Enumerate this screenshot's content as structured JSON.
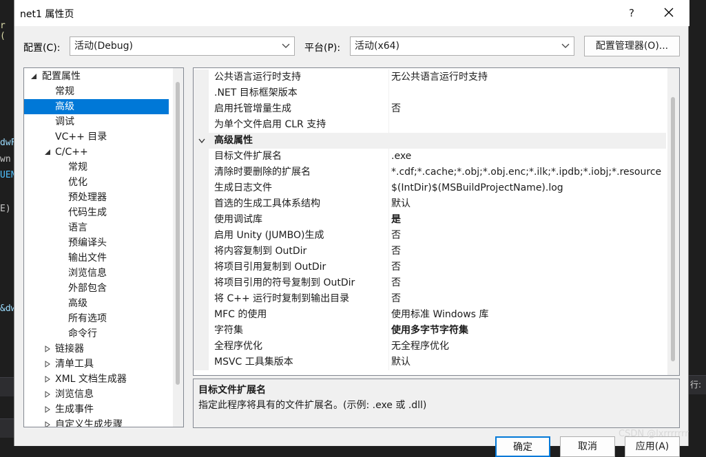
{
  "background": {
    "left_fragments": [
      "r (",
      "dwF",
      "wn",
      "UEN",
      "E)",
      "&dw"
    ],
    "right_fragment": "行:"
  },
  "watermark": "CSDN @lxrrrrrrr",
  "dialog": {
    "title": "net1 属性页",
    "help_label": "?",
    "config": {
      "label": "配置(C):",
      "value": "活动(Debug)"
    },
    "platform": {
      "label": "平台(P):",
      "value": "活动(x64)"
    },
    "manager_button": "配置管理器(O)..."
  },
  "tree": [
    {
      "label": "配置属性",
      "level": 0,
      "state": "expanded"
    },
    {
      "label": "常规",
      "level": 1
    },
    {
      "label": "高级",
      "level": 1,
      "selected": true
    },
    {
      "label": "调试",
      "level": 1
    },
    {
      "label": "VC++ 目录",
      "level": 1
    },
    {
      "label": "C/C++",
      "level": 1,
      "state": "expanded"
    },
    {
      "label": "常规",
      "level": 2
    },
    {
      "label": "优化",
      "level": 2
    },
    {
      "label": "预处理器",
      "level": 2
    },
    {
      "label": "代码生成",
      "level": 2
    },
    {
      "label": "语言",
      "level": 2
    },
    {
      "label": "预编译头",
      "level": 2
    },
    {
      "label": "输出文件",
      "level": 2
    },
    {
      "label": "浏览信息",
      "level": 2
    },
    {
      "label": "外部包含",
      "level": 2
    },
    {
      "label": "高级",
      "level": 2
    },
    {
      "label": "所有选项",
      "level": 2
    },
    {
      "label": "命令行",
      "level": 2
    },
    {
      "label": "链接器",
      "level": 1,
      "state": "collapsed"
    },
    {
      "label": "清单工具",
      "level": 1,
      "state": "collapsed"
    },
    {
      "label": "XML 文档生成器",
      "level": 1,
      "state": "collapsed"
    },
    {
      "label": "浏览信息",
      "level": 1,
      "state": "collapsed"
    },
    {
      "label": "生成事件",
      "level": 1,
      "state": "collapsed"
    },
    {
      "label": "自定义生成步骤",
      "level": 1,
      "state": "collapsed"
    }
  ],
  "properties": [
    {
      "name": "公共语言运行时支持",
      "value": "无公共语言运行时支持"
    },
    {
      "name": ".NET 目标框架版本",
      "value": ""
    },
    {
      "name": "启用托管增量生成",
      "value": "否"
    },
    {
      "name": "为单个文件启用 CLR 支持",
      "value": ""
    },
    {
      "name": "高级属性",
      "value": "",
      "category": true
    },
    {
      "name": "目标文件扩展名",
      "value": ".exe"
    },
    {
      "name": "清除时要删除的扩展名",
      "value": "*.cdf;*.cache;*.obj;*.obj.enc;*.ilk;*.ipdb;*.iobj;*.resource"
    },
    {
      "name": "生成日志文件",
      "value": "$(IntDir)$(MSBuildProjectName).log"
    },
    {
      "name": "首选的生成工具体系结构",
      "value": "默认"
    },
    {
      "name": "使用调试库",
      "value": "是",
      "bold": true
    },
    {
      "name": "启用 Unity (JUMBO)生成",
      "value": "否"
    },
    {
      "name": "将内容复制到 OutDir",
      "value": "否"
    },
    {
      "name": "将项目引用复制到 OutDir",
      "value": "否"
    },
    {
      "name": "将项目引用的符号复制到 OutDir",
      "value": "否"
    },
    {
      "name": "将 C++ 运行时复制到输出目录",
      "value": "否"
    },
    {
      "name": "MFC 的使用",
      "value": "使用标准 Windows 库"
    },
    {
      "name": "字符集",
      "value": "使用多字节字符集",
      "bold": true
    },
    {
      "name": "全程序优化",
      "value": "无全程序优化"
    },
    {
      "name": "MSVC 工具集版本",
      "value": "默认"
    }
  ],
  "description": {
    "title": "目标文件扩展名",
    "text": "指定此程序将具有的文件扩展名。(示例: .exe 或 .dll)"
  },
  "buttons": {
    "ok": "确定",
    "cancel": "取消",
    "apply": "应用(A)"
  },
  "colors": {
    "selection": "#0078d7",
    "dialog_bg": "#f0f0f0",
    "ide_bg": "#1e1e1e"
  }
}
